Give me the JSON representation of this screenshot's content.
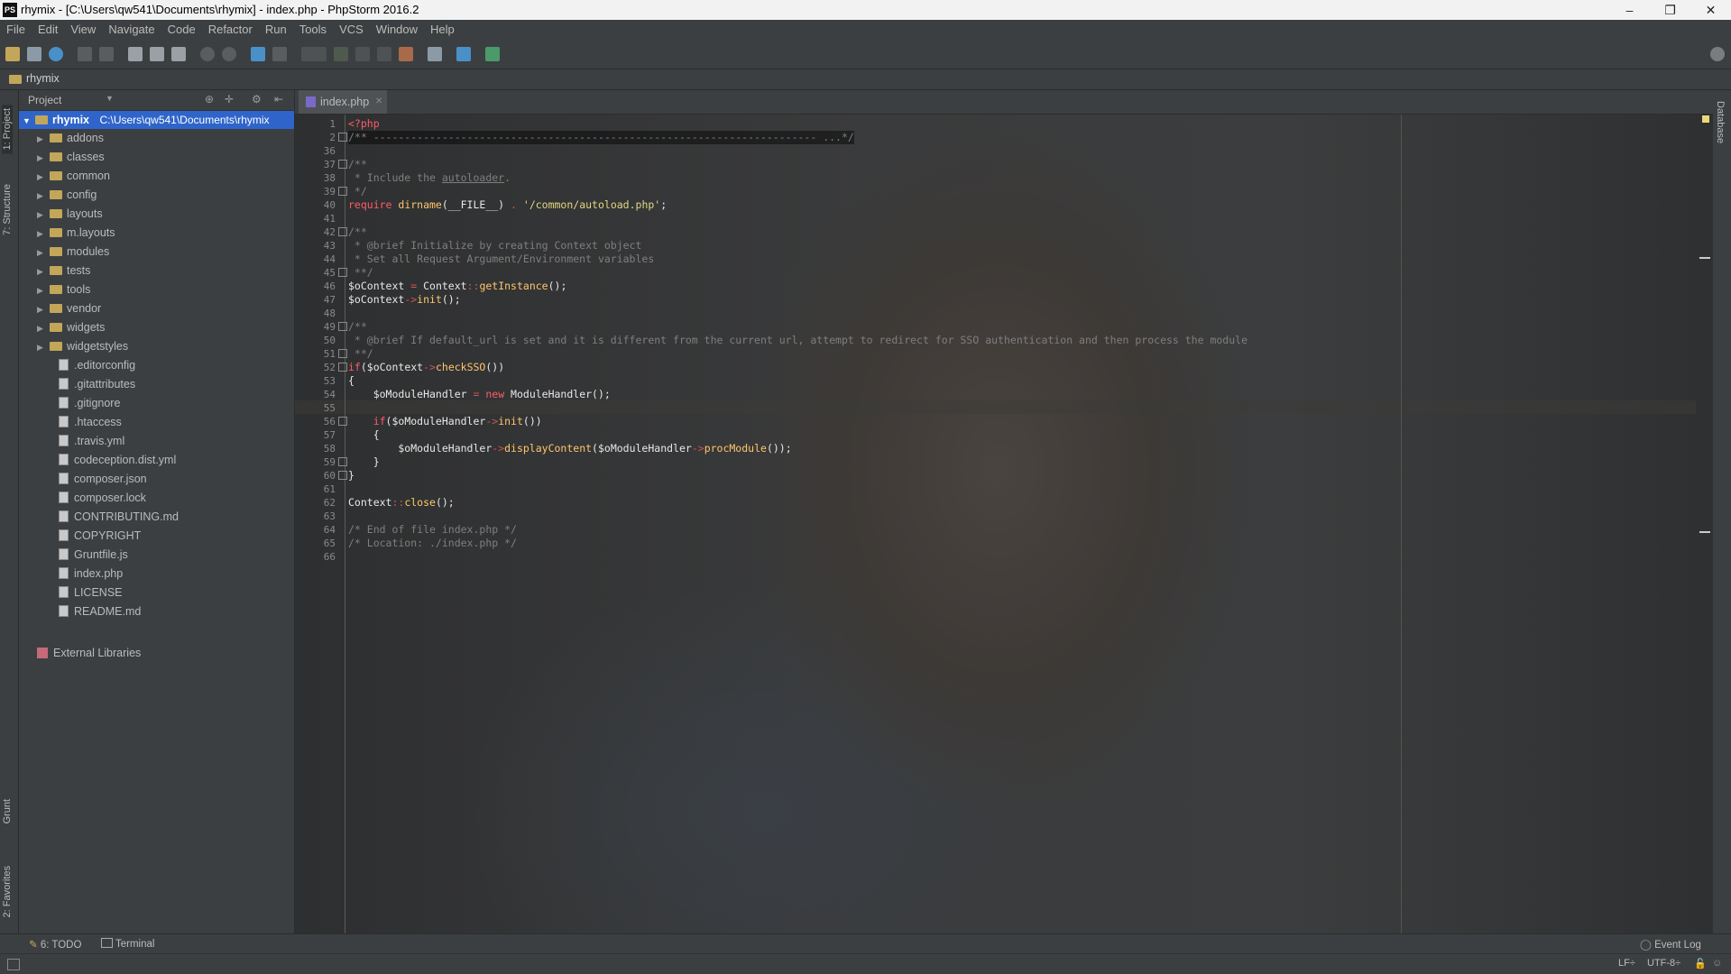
{
  "window": {
    "title": "rhymix - [C:\\Users\\qw541\\Documents\\rhymix] - index.php - PhpStorm 2016.2",
    "app_icon": "PS",
    "minimize": "–",
    "restore": "❐",
    "close": "✕"
  },
  "menu": [
    "File",
    "Edit",
    "View",
    "Navigate",
    "Code",
    "Refactor",
    "Run",
    "Tools",
    "VCS",
    "Window",
    "Help"
  ],
  "navbar": {
    "project": "rhymix"
  },
  "tool_strip_left": {
    "project": "1: Project",
    "structure": "7: Structure",
    "grunt": "Grunt",
    "favorites": "2: Favorites"
  },
  "tool_strip_right": {
    "database": "Database"
  },
  "project_panel": {
    "view_selector": "Project",
    "root": {
      "name": "rhymix",
      "path": "C:\\Users\\qw541\\Documents\\rhymix"
    },
    "folders": [
      "addons",
      "classes",
      "common",
      "config",
      "layouts",
      "m.layouts",
      "modules",
      "tests",
      "tools",
      "vendor",
      "widgets",
      "widgetstyles"
    ],
    "files": [
      ".editorconfig",
      ".gitattributes",
      ".gitignore",
      ".htaccess",
      ".travis.yml",
      "codeception.dist.yml",
      "composer.json",
      "composer.lock",
      "CONTRIBUTING.md",
      "COPYRIGHT",
      "Gruntfile.js",
      "index.php",
      "LICENSE",
      "README.md"
    ],
    "external": "External Libraries"
  },
  "editor": {
    "tab": "index.php",
    "line_numbers": [
      "1",
      "2",
      "36",
      "37",
      "38",
      "39",
      "40",
      "41",
      "42",
      "43",
      "44",
      "45",
      "46",
      "47",
      "48",
      "49",
      "50",
      "51",
      "52",
      "53",
      "54",
      "55",
      "56",
      "57",
      "58",
      "59",
      "60",
      "61",
      "62",
      "63",
      "64",
      "65",
      "66"
    ],
    "code": {
      "l1": "<?php",
      "l2": "/** ----------------------------------------------------------------------- ...*/",
      "l37": "/**",
      "l38a": " * Include the ",
      "l38b": "autoloader",
      "l38c": ".",
      "l39": " */",
      "l40a": "require ",
      "l40b": "dirname",
      "l40c": "(__FILE__) ",
      "l40d": ". ",
      "l40e": "'/common/autoload.php'",
      "l40f": ";",
      "l42": "/**",
      "l43": " * @brief Initialize by creating Context object",
      "l44": " * Set all Request Argument/Environment variables",
      "l45": " **/",
      "l46a": "$oContext ",
      "l46b": "= ",
      "l46c": "Context",
      "l46d": "::",
      "l46e": "getInstance",
      "l46f": "();",
      "l47a": "$oContext",
      "l47b": "->",
      "l47c": "init",
      "l47d": "();",
      "l49": "/**",
      "l50": " * @brief If default_url is set and it is different from the current url, attempt to redirect for SSO authentication and then process the module",
      "l51": " **/",
      "l52a": "if",
      "l52b": "($oContext",
      "l52c": "->",
      "l52d": "checkSSO",
      "l52e": "())",
      "l53": "{",
      "l54a": "    $oModuleHandler ",
      "l54b": "= ",
      "l54c": "new ",
      "l54d": "ModuleHandler();",
      "l56a": "    if",
      "l56b": "($oModuleHandler",
      "l56c": "->",
      "l56d": "init",
      "l56e": "())",
      "l57": "    {",
      "l58a": "        $oModuleHandler",
      "l58b": "->",
      "l58c": "displayContent",
      "l58d": "($oModuleHandler",
      "l58e": "->",
      "l58f": "procModule",
      "l58g": "());",
      "l59": "    }",
      "l60": "}",
      "l62a": "Context",
      "l62b": "::",
      "l62c": "close",
      "l62d": "();",
      "l64": "/* End of file index.php */",
      "l65": "/* Location: ./index.php */"
    }
  },
  "bottom_tools": {
    "todo": "6: TODO",
    "terminal": "Terminal",
    "event_log": "Event Log"
  },
  "status": {
    "line_sep": "LF÷",
    "encoding": "UTF-8÷"
  }
}
